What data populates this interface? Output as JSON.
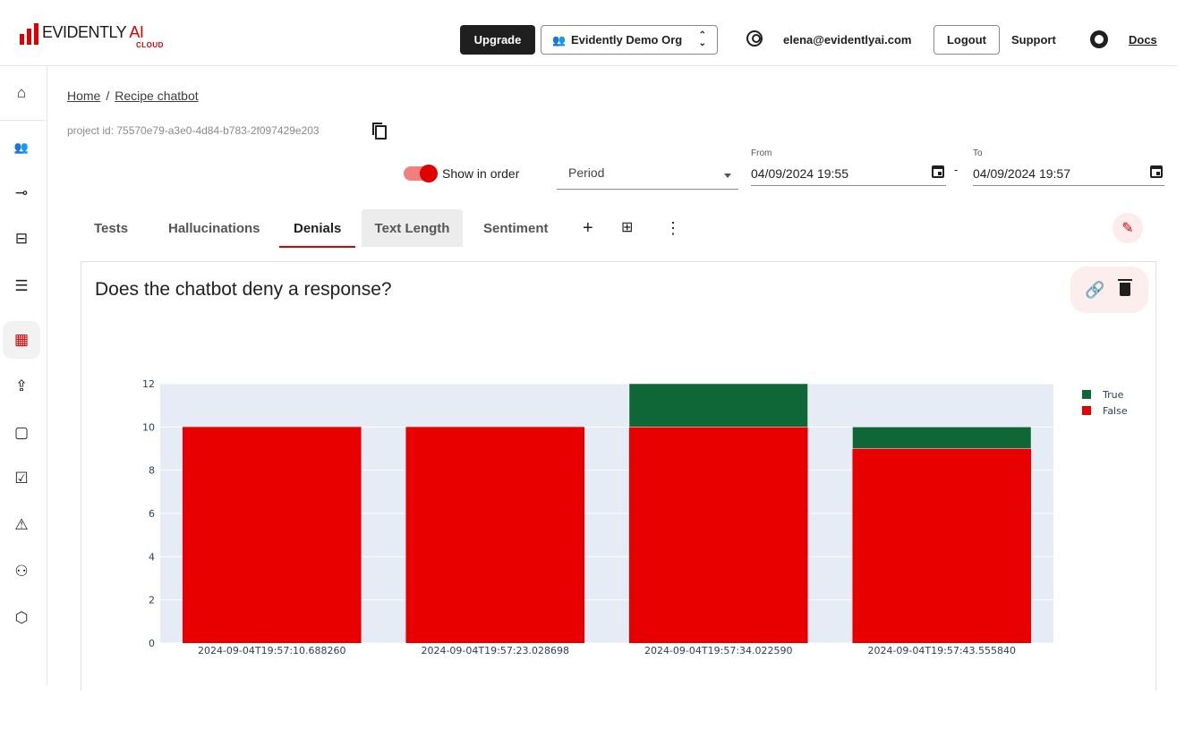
{
  "header": {
    "logo_text": "EVIDENTLY",
    "logo_ai": "AI",
    "logo_sub": "CLOUD",
    "upgrade_label": "Upgrade",
    "org_name": "Evidently Demo Org",
    "email": "elena@evidentlyai.com",
    "logout_label": "Logout",
    "support_label": "Support",
    "docs_label": "Docs"
  },
  "sidebar": {
    "items": [
      {
        "name": "home-icon",
        "glyph": "⌂"
      },
      {
        "name": "users-icon",
        "glyph": "👥"
      },
      {
        "name": "key-icon",
        "glyph": "⊸"
      },
      {
        "name": "dashboard-icon",
        "glyph": "⊟"
      },
      {
        "name": "list-icon",
        "glyph": "☰"
      },
      {
        "name": "panels-icon",
        "glyph": "▦"
      },
      {
        "name": "upload-icon",
        "glyph": "⇪"
      },
      {
        "name": "report-icon",
        "glyph": "▢"
      },
      {
        "name": "checklist-icon",
        "glyph": "☑"
      },
      {
        "name": "warning-icon",
        "glyph": "⚠"
      },
      {
        "name": "add-user-icon",
        "glyph": "⚇"
      },
      {
        "name": "cube-icon",
        "glyph": "⬡"
      }
    ]
  },
  "breadcrumb": {
    "home": "Home",
    "sep": "/",
    "project": "Recipe chatbot"
  },
  "project_id": "project id: 75570e79-a3e0-4d84-b783-2f097429e203",
  "controls": {
    "show_in_order": "Show in order",
    "period_placeholder": "Period",
    "from_label": "From",
    "from_value": "04/09/2024 19:55",
    "dash": "-",
    "to_label": "To",
    "to_value": "04/09/2024 19:57"
  },
  "tabs": [
    "Tests",
    "Hallucinations",
    "Denials",
    "Text Length",
    "Sentiment"
  ],
  "panel": {
    "title": "Does the chatbot deny a response?"
  },
  "colors": {
    "true": "#0f6636",
    "false": "#e80000",
    "plot_bg": "#e5ecf6"
  },
  "chart_data": {
    "type": "bar",
    "stacked": true,
    "categories": [
      "2024-09-04T19:57:10.688260",
      "2024-09-04T19:57:23.028698",
      "2024-09-04T19:57:34.022590",
      "2024-09-04T19:57:43.555840"
    ],
    "series": [
      {
        "name": "False",
        "values": [
          10,
          10,
          10,
          9
        ]
      },
      {
        "name": "True",
        "values": [
          0,
          0,
          2,
          1
        ]
      }
    ],
    "legend": [
      "True",
      "False"
    ],
    "legend_placement": "top-right",
    "ylim": [
      0,
      12
    ],
    "yticks": [
      0,
      2,
      4,
      6,
      8,
      10,
      12
    ],
    "grid": true
  }
}
